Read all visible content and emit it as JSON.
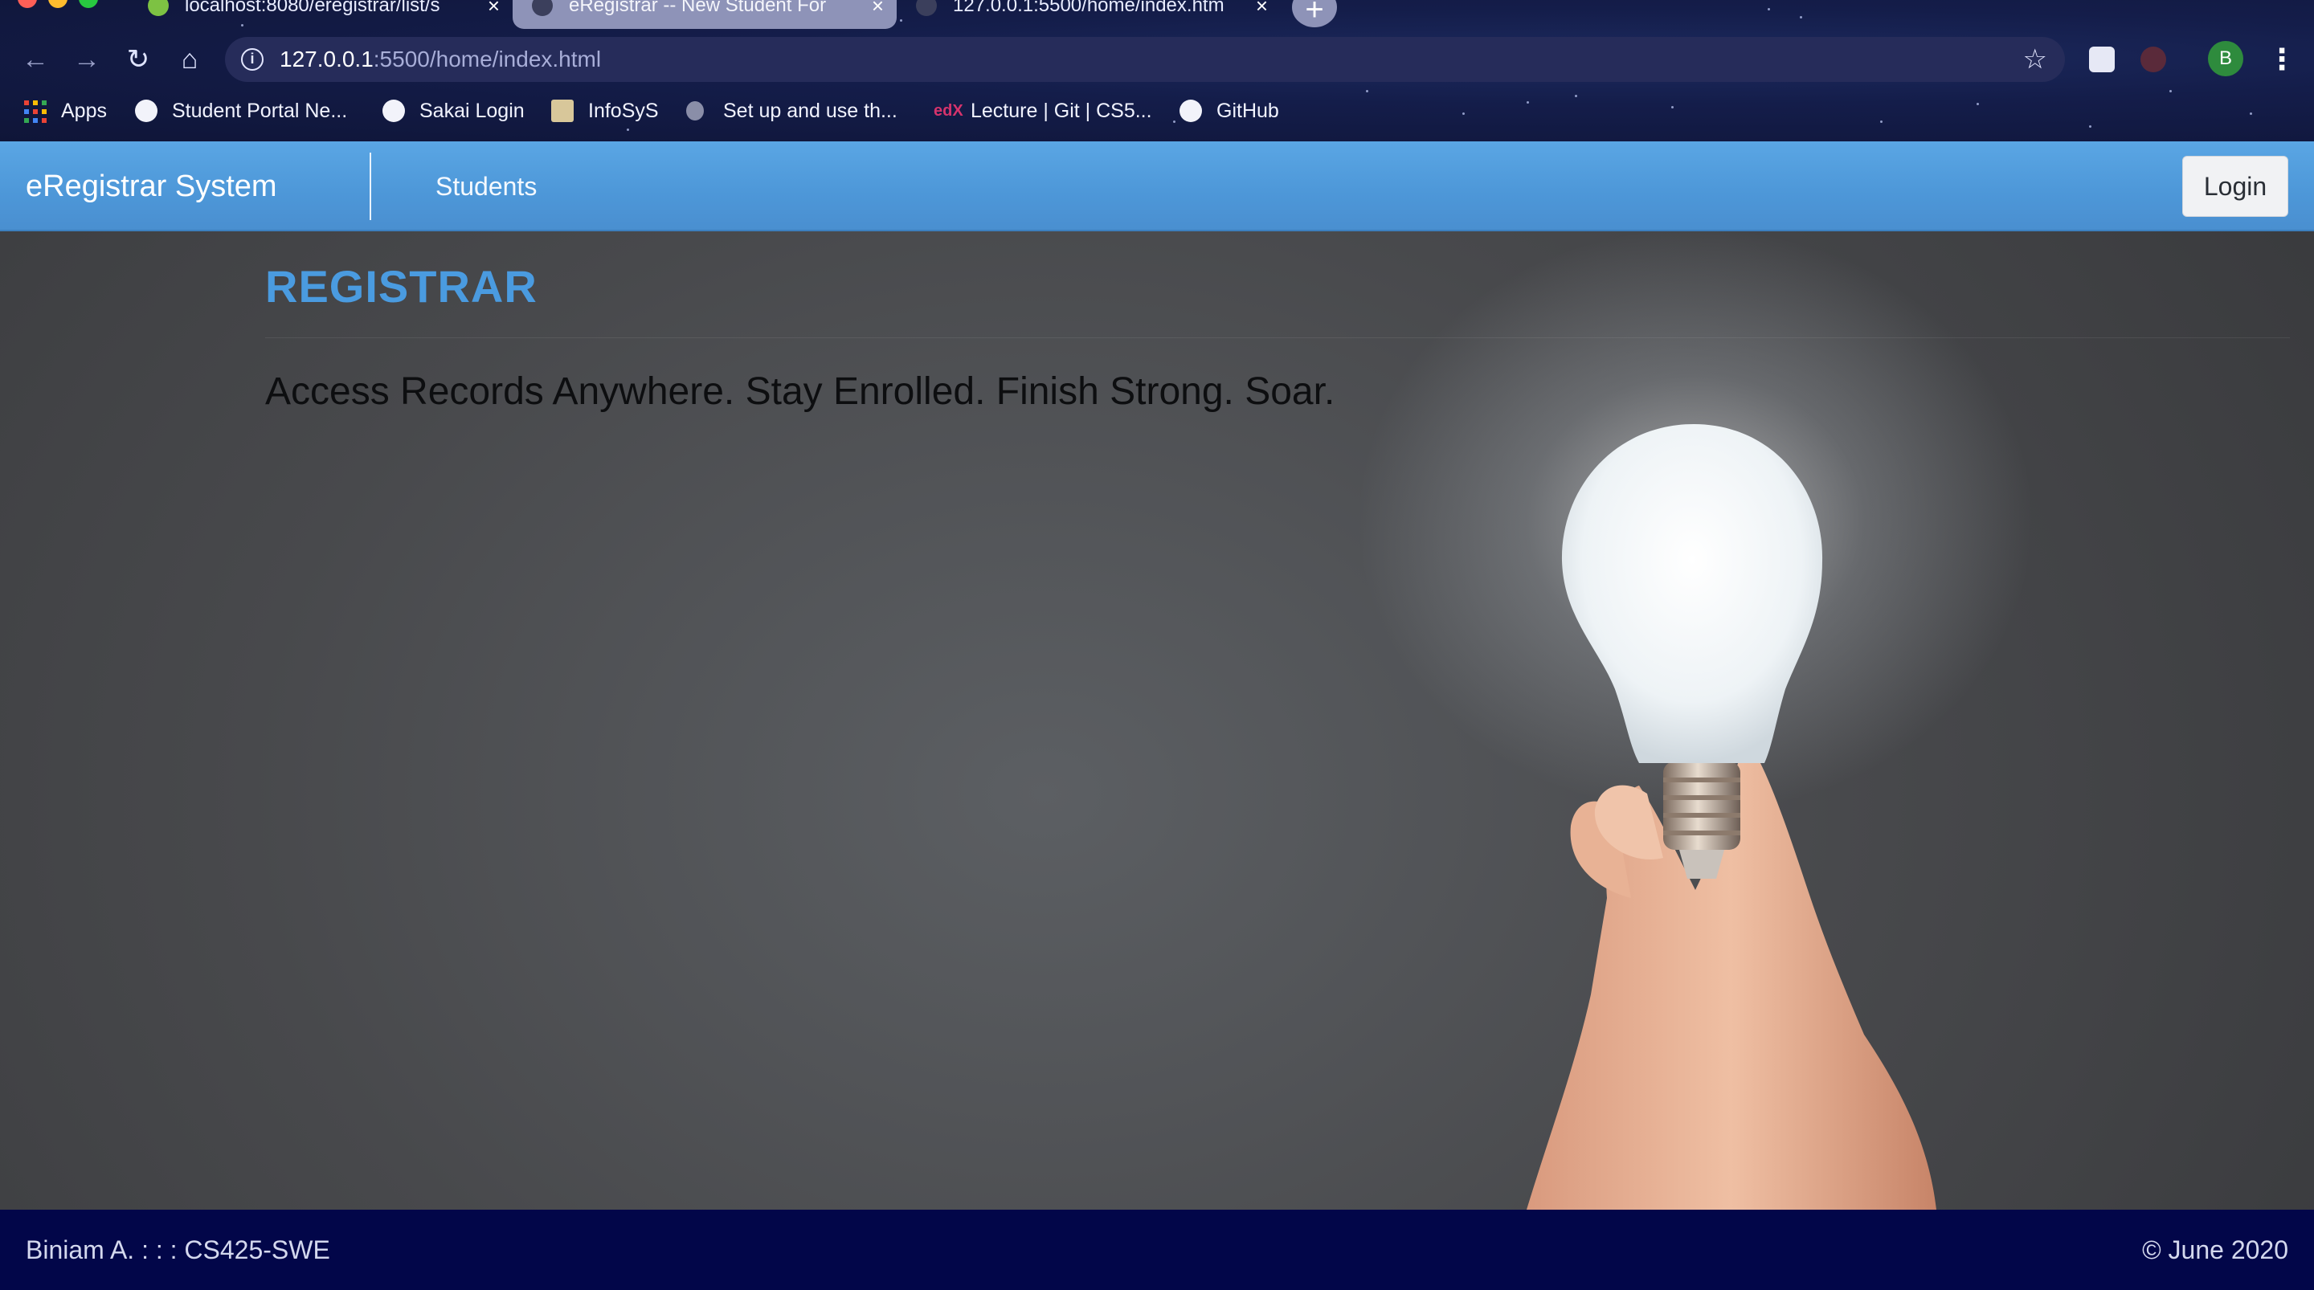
{
  "browser": {
    "tabs": [
      {
        "title": "localhost:8080/eregistrar/list/s",
        "active": false
      },
      {
        "title": "eRegistrar -- New Student For",
        "active": true
      },
      {
        "title": "127.0.0.1:5500/home/index.htm",
        "active": false
      }
    ],
    "address_bar": {
      "host": "127.0.0.1",
      "path": ":5500/home/index.html"
    },
    "profile_initial": "B",
    "bookmarks": [
      {
        "label": "Apps",
        "icon": "apps-grid-icon"
      },
      {
        "label": "Student Portal Ne...",
        "icon": "globe-icon"
      },
      {
        "label": "Sakai Login",
        "icon": "globe-icon"
      },
      {
        "label": "InfoSyS",
        "icon": "infosys-icon"
      },
      {
        "label": "Set up and use th...",
        "icon": "apple-icon"
      },
      {
        "label": "Lecture | Git | CS5...",
        "icon": "edx-icon"
      },
      {
        "label": "GitHub",
        "icon": "github-icon"
      }
    ]
  },
  "navbar": {
    "brand": "eRegistrar System",
    "links": [
      {
        "label": "Students"
      }
    ],
    "login_label": "Login"
  },
  "hero": {
    "title": "REGISTRAR",
    "tagline": "Access Records Anywhere. Stay Enrolled. Finish Strong. Soar."
  },
  "footer": {
    "left": "Biniam A. : : : CS425-SWE",
    "right": "© June 2020"
  },
  "colors": {
    "navbar": "#4d97d8",
    "accent_title": "#4a9be0",
    "footer": "#020649"
  }
}
